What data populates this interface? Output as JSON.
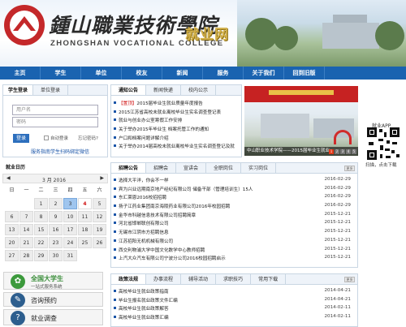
{
  "header": {
    "school_name_cn": "鍾山職業技術學院",
    "school_name_en": "ZHONGSHAN VOCATIONAL COLLEGE",
    "site_name": "就业网"
  },
  "nav": [
    "主页",
    "学生",
    "单位",
    "校友",
    "新闻",
    "服务",
    "关于我们",
    "回到旧版"
  ],
  "login": {
    "title": "学生登录",
    "tab": "单位登录",
    "username_placeholder": "用户名",
    "password_placeholder": "密码",
    "login_btn": "登录",
    "auto_login": "自动登录",
    "forgot": "忘记密码?",
    "service_guide": "服务指南",
    "student_binding": "学生扫码绑定微信"
  },
  "notice": {
    "tabs": [
      "通知公告",
      "新闻快递",
      "校内公示"
    ],
    "more": "更多",
    "items": [
      {
        "tag": "【置顶】",
        "text": "2015届毕业生就业质量年度报告"
      },
      {
        "tag": "",
        "text": "2015江苏省高校未就业离校毕业生实名调查登记表"
      },
      {
        "tag": "",
        "text": "就业与创业办公室寒假工作安排"
      },
      {
        "tag": "",
        "text": "关于举办2015年毕业生 档案托管工作的通知"
      },
      {
        "tag": "",
        "text": "户口和档案问题详解介绍"
      },
      {
        "tag": "",
        "text": "关于举办2014届高校未就业离校毕业生实名调查登记及就"
      }
    ]
  },
  "news_photo": {
    "caption": "中山职业技术学院——2015届毕业生就业",
    "pages": [
      "1",
      "2",
      "3",
      "4",
      "5"
    ]
  },
  "app": {
    "title": "就业APP",
    "caption": "扫描，点击下载"
  },
  "calendar": {
    "title": "就业日历",
    "month_label": "3 月 2016",
    "weekdays": [
      "日",
      "一",
      "二",
      "三",
      "四",
      "五",
      "六"
    ],
    "days": [
      "",
      "",
      "1",
      "2",
      "3",
      "4",
      "5",
      "6",
      "7",
      "8",
      "9",
      "10",
      "11",
      "12",
      "13",
      "14",
      "15",
      "16",
      "17",
      "18",
      "19",
      "20",
      "21",
      "22",
      "23",
      "24",
      "25",
      "26",
      "27",
      "28",
      "29",
      "30",
      "31",
      "",
      ""
    ],
    "today": "3",
    "selected": "4"
  },
  "recruit": {
    "tabs": [
      "招聘公告",
      "招聘会",
      "宣讲会",
      "全职岗位",
      "实习岗位"
    ],
    "more": "更多",
    "items": [
      {
        "text": "选择大平洋，你会不一样",
        "date": "2016-02-29"
      },
      {
        "text": "宾为兴业远期南京地产经纪有限公司 储备干部（管理培训生）15人",
        "date": "2016-02-29"
      },
      {
        "text": "东汇莱恩2016校招招聘",
        "date": "2016-02-29"
      },
      {
        "text": "扬子江药业集团南京海陵药业有限公司2016年校园招聘",
        "date": "2016-02-29"
      },
      {
        "text": "金华市科越信息技术有限公司招聘简章",
        "date": "2015-12-21"
      },
      {
        "text": "河北省邯郸联创有限公司",
        "date": "2015-12-21"
      },
      {
        "text": "无锡市江阴市方招聘信息",
        "date": "2015-12-21"
      },
      {
        "text": "江苏招阳无机机械有限公司",
        "date": "2015-12-21"
      },
      {
        "text": "西交利物浦大学中国文化数学中心教师招聘",
        "date": "2015-12-21"
      },
      {
        "text": "上汽大众汽车有限公司宁波分公司2016校园招聘启示",
        "date": "2015-12-21"
      }
    ]
  },
  "policy": {
    "tabs": [
      "政策法规",
      "办事流程",
      "辅导活动",
      "求职技巧",
      "常用下载"
    ],
    "more": "更多",
    "items": [
      {
        "text": "高校毕业生就业政策指南",
        "date": "2014-04-21"
      },
      {
        "text": "毕业生报名就业政策文件汇编",
        "date": "2014-04-21"
      },
      {
        "text": "高校毕业生就业政策解答",
        "date": "2014-02-11"
      },
      {
        "text": "高校毕业生就业政策汇编",
        "date": "2014-02-11"
      }
    ]
  },
  "side": {
    "college_brand": "全国大学生",
    "college_sub": "一站式服务系统",
    "consult": "咨询预约",
    "survey": "就业调查"
  }
}
